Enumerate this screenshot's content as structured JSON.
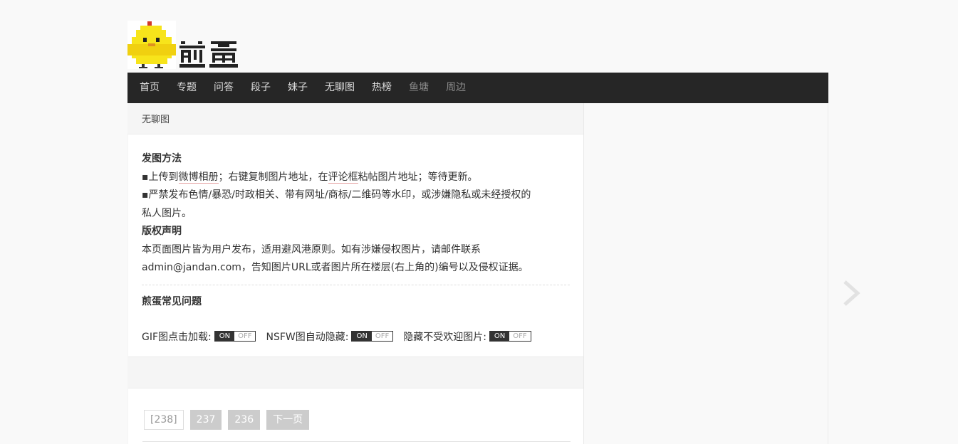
{
  "site": {
    "logo_text": "煎蛋"
  },
  "nav": [
    {
      "label": "首页",
      "dim": false
    },
    {
      "label": "专题",
      "dim": false
    },
    {
      "label": "问答",
      "dim": false
    },
    {
      "label": "段子",
      "dim": false
    },
    {
      "label": "妹子",
      "dim": false
    },
    {
      "label": "无聊图",
      "dim": false
    },
    {
      "label": "热榜",
      "dim": false
    },
    {
      "label": "鱼塘",
      "dim": true
    },
    {
      "label": "周边",
      "dim": true
    }
  ],
  "breadcrumb": "无聊图",
  "notice": {
    "howto_title": "发图方法",
    "howto_line1_a": "▪上传到",
    "howto_line1_link1": "微博相册",
    "howto_line1_b": "；右键复制图片地址，在",
    "howto_line1_link2": "评论框",
    "howto_line1_c": "粘帖图片地址；等待更新。",
    "howto_line2": "▪严禁发布色情/暴恐/时政相关、带有网址/商标/二维码等水印，或涉嫌隐私或未经授权的",
    "howto_line3": "私人图片。",
    "copyright_title": "版权声明",
    "copyright_line1": "本页面图片皆为用户发布，适用避风港原则。如有涉嫌侵权图片，请邮件联系",
    "copyright_line2": "admin@jandan.com，告知图片URL或者图片所在楼层(右上角的)编号以及侵权证据。",
    "faq": "煎蛋常见问题"
  },
  "toggles": [
    {
      "label": "GIF图点击加载:",
      "on": "ON",
      "off": "OFF"
    },
    {
      "label": "NSFW图自动隐藏:",
      "on": "ON",
      "off": "OFF"
    },
    {
      "label": "隐藏不受欢迎图片:",
      "on": "ON",
      "off": "OFF"
    }
  ],
  "pager": {
    "current": "[238]",
    "pages": [
      "237",
      "236"
    ],
    "next": "下一页"
  },
  "icons": {
    "logo": "chick-logo-icon",
    "next": "chevron-right-icon"
  },
  "colors": {
    "nav_bg": "#262626",
    "chick_yellow": "#f7e41b"
  }
}
